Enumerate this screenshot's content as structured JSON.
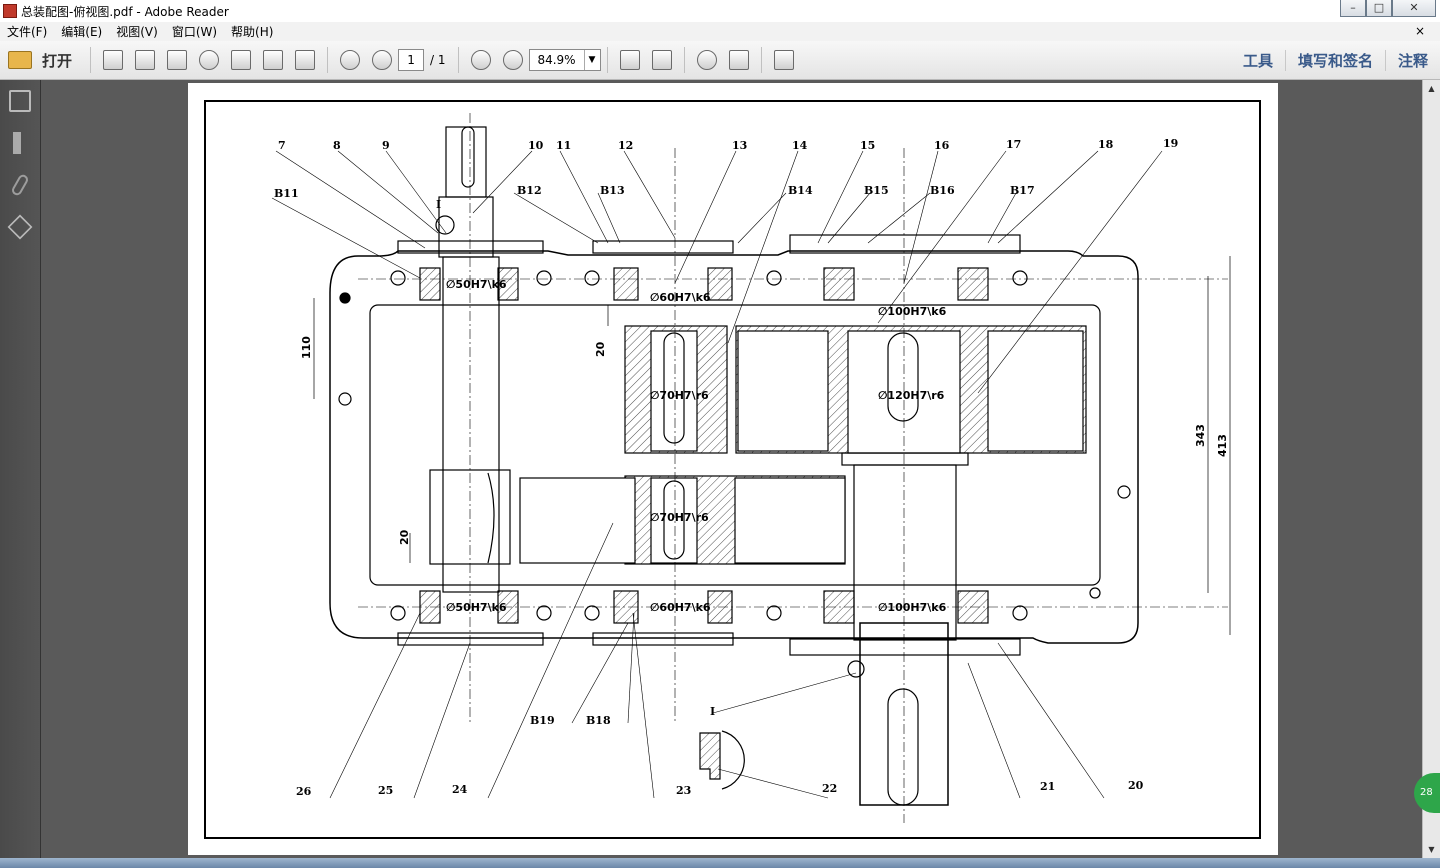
{
  "window": {
    "title": "总装配图-俯视图.pdf - Adobe Reader"
  },
  "menu": {
    "items": [
      "文件(F)",
      "编辑(E)",
      "视图(V)",
      "窗口(W)",
      "帮助(H)"
    ],
    "close": "×"
  },
  "toolbar": {
    "open_label": "打开",
    "page_current": "1",
    "page_total": "/ 1",
    "zoom": "84.9%",
    "tools_label": "工具",
    "fill_sign_label": "填写和签名",
    "comment_label": "注释"
  },
  "badge": {
    "text": "28"
  },
  "drawing": {
    "part_numbers_top": [
      "7",
      "8",
      "9",
      "10",
      "11",
      "12",
      "13",
      "14",
      "15",
      "16",
      "17",
      "18",
      "19"
    ],
    "bearing_labels_top": [
      "B11",
      "B12",
      "B13",
      "B14",
      "B15",
      "B16",
      "B17"
    ],
    "part_numbers_bottom": [
      "26",
      "25",
      "24",
      "23",
      "22",
      "21",
      "20"
    ],
    "bearing_labels_bottom": [
      "B19",
      "B18"
    ],
    "detail_label": "I",
    "fits": [
      "∅50H7\\k6",
      "∅60H7\\k6",
      "∅100H7\\k6",
      "∅70H7\\r6",
      "∅120H7\\r6",
      "∅70H7\\r6",
      "∅50H7\\k6",
      "∅60H7\\k6",
      "∅100H7\\k6"
    ],
    "dimensions": {
      "d110": "110",
      "d20a": "20",
      "d20b": "20",
      "d343": "343",
      "d413": "413"
    }
  }
}
